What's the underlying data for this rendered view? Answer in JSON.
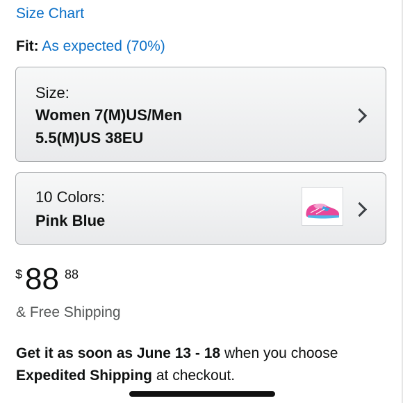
{
  "size_chart_link": "Size Chart",
  "fit": {
    "label": "Fit:",
    "value": "As expected (70%)"
  },
  "size_selector": {
    "label": "Size:",
    "value_line1": "Women 7(M)US/Men",
    "value_line2": "5.5(M)US 38EU"
  },
  "color_selector": {
    "label": "10 Colors:",
    "value": "Pink Blue",
    "thumbnail_icon": "pink-blue-sneaker"
  },
  "price": {
    "currency": "$",
    "whole": "88",
    "fraction": "88"
  },
  "shipping": "& Free Shipping",
  "delivery": {
    "prefix": "Get it as soon as June 13 - 18",
    "middle": " when you choose ",
    "method": "Expedited Shipping",
    "suffix": " at checkout."
  },
  "colors": {
    "link": "#0a6fc7",
    "text": "#0f1111",
    "muted": "#565959"
  }
}
